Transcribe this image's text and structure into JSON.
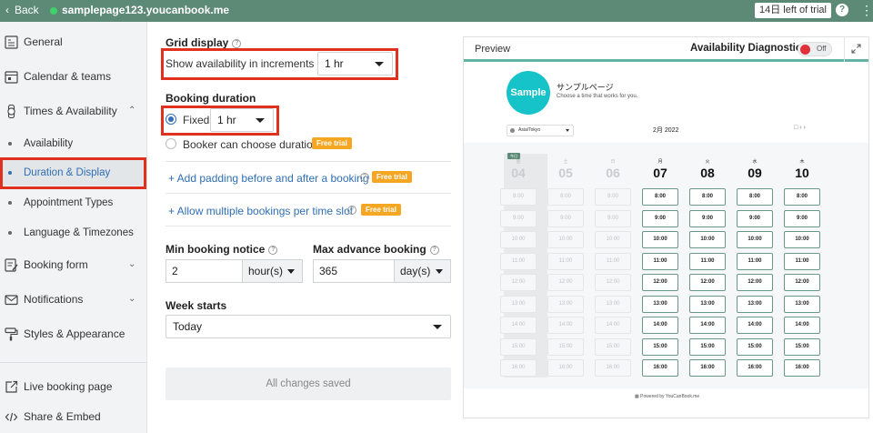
{
  "topbar": {
    "back_label": "Back",
    "url": "samplepage123.youcanbook.me",
    "trial_badge": "14日 left of trial",
    "help": "?",
    "menu": "⋮"
  },
  "sidebar": {
    "items": [
      {
        "id": "general",
        "label": "General"
      },
      {
        "id": "calendar",
        "label": "Calendar & teams"
      },
      {
        "id": "times",
        "label": "Times & Availability"
      },
      {
        "id": "booking-form",
        "label": "Booking form"
      },
      {
        "id": "notifications",
        "label": "Notifications"
      },
      {
        "id": "styles",
        "label": "Styles & Appearance"
      },
      {
        "id": "live-page",
        "label": "Live booking page"
      },
      {
        "id": "share",
        "label": "Share & Embed"
      }
    ],
    "sub_items": [
      {
        "id": "availability",
        "label": "Availability"
      },
      {
        "id": "duration",
        "label": "Duration & Display"
      },
      {
        "id": "appointment-types",
        "label": "Appointment Types"
      },
      {
        "id": "language",
        "label": "Language & Timezones"
      }
    ]
  },
  "settings": {
    "grid_display_label": "Grid display",
    "increments_label": "Show availability in increments of",
    "increments_value": "1 hr",
    "booking_duration_label": "Booking duration",
    "fixed_label": "Fixed",
    "fixed_value": "1 hr",
    "booker_choose_label": "Booker can choose duration",
    "free_trial": "Free trial",
    "add_padding_link": "+ Add padding before and after a booking",
    "allow_multiple_link": "+ Allow multiple bookings per time slot",
    "min_notice_label": "Min booking notice",
    "min_notice_value": "2",
    "min_notice_unit": "hour(s)",
    "max_advance_label": "Max advance booking",
    "max_advance_value": "365",
    "max_advance_unit": "day(s)",
    "week_starts_label": "Week starts",
    "week_starts_value": "Today",
    "save_label": "All changes saved"
  },
  "preview": {
    "title": "Preview",
    "diagnostics_label": "Availability Diagnostics",
    "toggle_label": "Off",
    "logo_text": "Sample",
    "page_name": "サンプルページ",
    "page_subtitle": "Choose a time that works for you.",
    "timezone": "Asia/Tokyo",
    "month": "2月 2022",
    "today_tag": "今日",
    "days": [
      {
        "weekday": "金",
        "date": "04",
        "active": false
      },
      {
        "weekday": "土",
        "date": "05",
        "active": false
      },
      {
        "weekday": "日",
        "date": "06",
        "active": false
      },
      {
        "weekday": "月",
        "date": "07",
        "active": true
      },
      {
        "weekday": "火",
        "date": "08",
        "active": true
      },
      {
        "weekday": "水",
        "date": "09",
        "active": true
      },
      {
        "weekday": "木",
        "date": "10",
        "active": true
      }
    ],
    "times": [
      "8:00",
      "9:00",
      "10:00",
      "11:00",
      "12:00",
      "13:00",
      "14:00",
      "15:00",
      "16:00"
    ],
    "powered_by": "Powered by YouCanBook.me"
  }
}
